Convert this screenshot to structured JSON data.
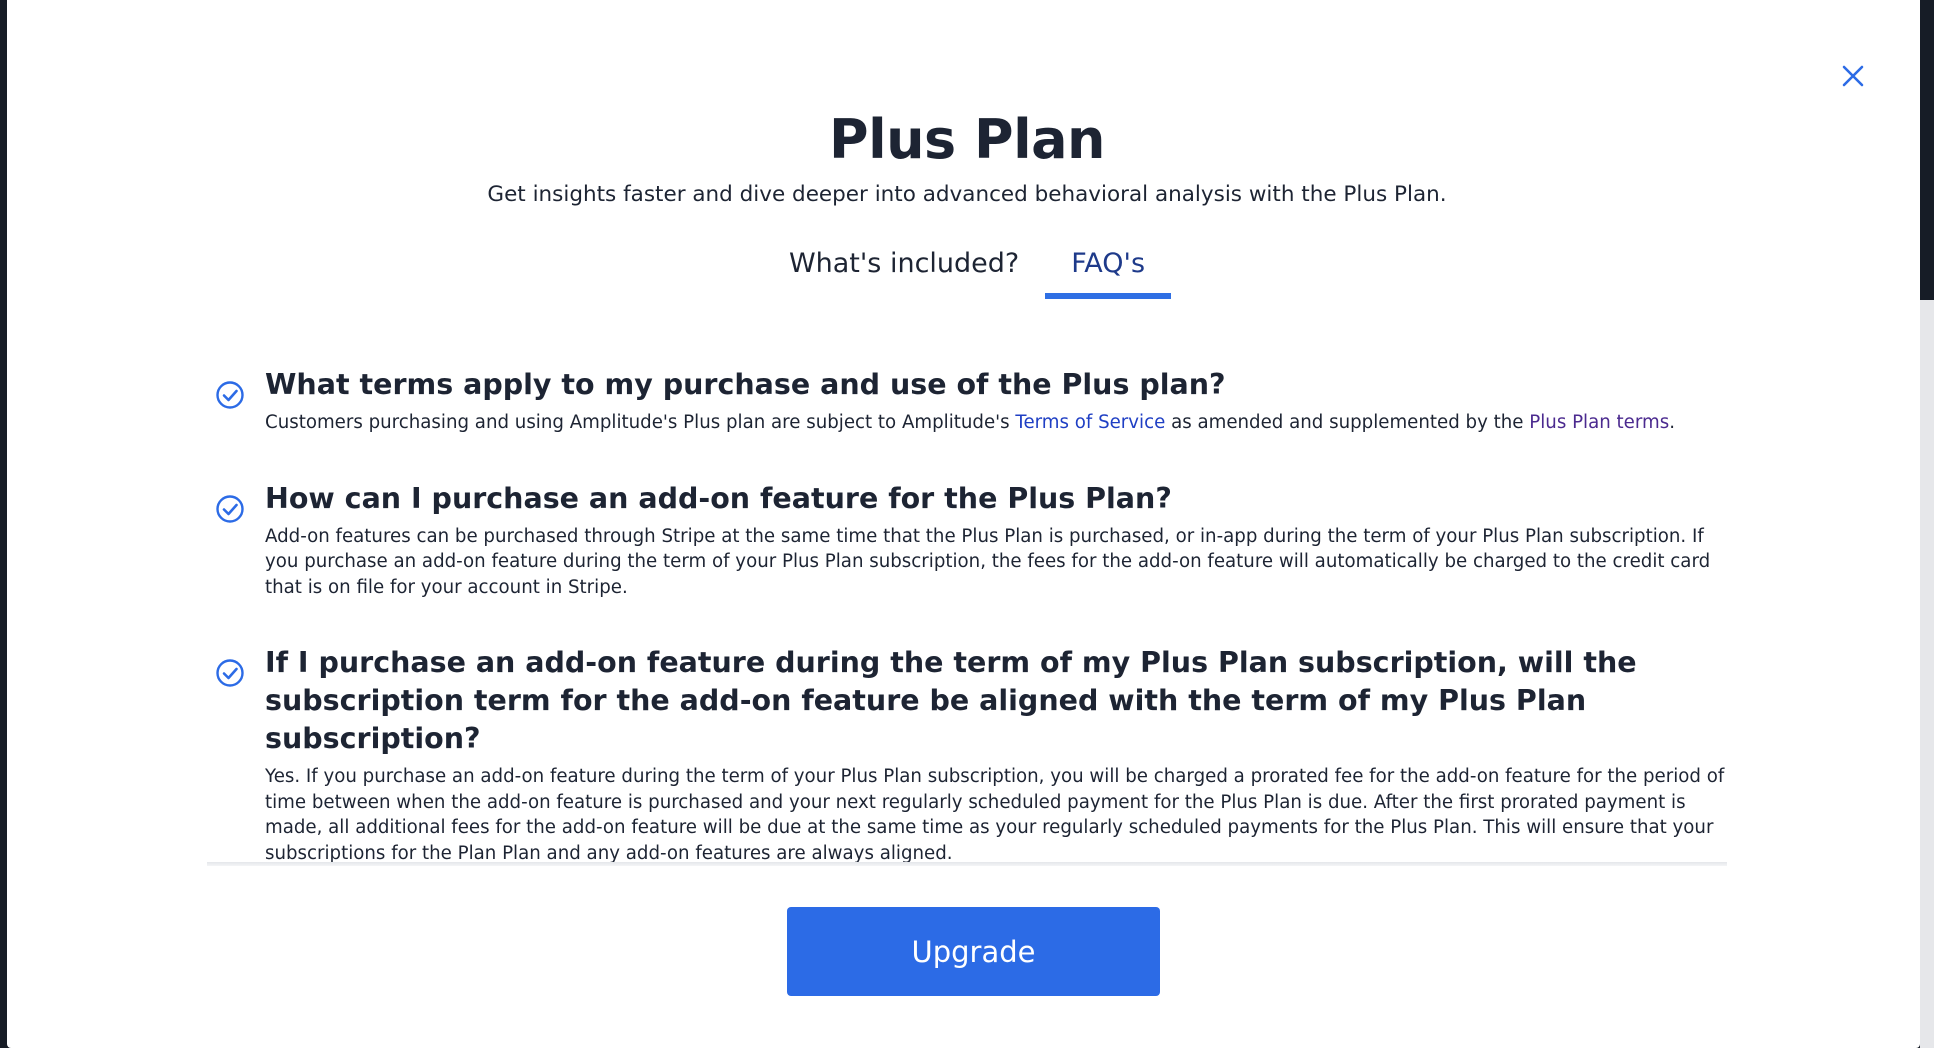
{
  "modal": {
    "title": "Plus Plan",
    "subtitle": "Get insights faster and dive deeper into advanced behavioral analysis with the Plus Plan.",
    "close_icon": "close-icon"
  },
  "tabs": [
    {
      "label": "What's included?",
      "active": false
    },
    {
      "label": "FAQ's",
      "active": true
    }
  ],
  "faqs": [
    {
      "icon": "check-circle-icon",
      "question": "What terms apply to my purchase and use of the Plus plan?",
      "answer_part1": "Customers purchasing and using Amplitude's Plus plan are subject to Amplitude's ",
      "link1": "Terms of Service",
      "answer_part2": " as amended and supplemented by the ",
      "link2": "Plus Plan terms",
      "answer_part3": "."
    },
    {
      "icon": "check-circle-icon",
      "question": "How can I purchase an add-on feature for the Plus Plan?",
      "answer": "Add-on features can be purchased through Stripe at the same time that the Plus Plan is purchased, or in-app during the term of your Plus Plan subscription. If you purchase an add-on feature during the term of your Plus Plan subscription, the fees for the add-on feature will automatically be charged to the credit card that is on file for your account in Stripe."
    },
    {
      "icon": "check-circle-icon",
      "question": "If I purchase an add-on feature during the term of my Plus Plan subscription, will the subscription term for the add-on feature be aligned with the term of my Plus Plan subscription?",
      "answer": "Yes. If you purchase an add-on feature during the term of your Plus Plan subscription, you will be charged a prorated fee for the add-on feature for the period of time between when the add-on feature is purchased and your next regularly scheduled payment for the Plus Plan is due. After the first prorated payment is made, all additional fees for the add-on feature will be due at the same time as your regularly scheduled payments for the Plus Plan. This will ensure that your subscriptions for the Plan Plan and any add-on features are always aligned."
    }
  ],
  "upgrade": {
    "label": "Upgrade"
  },
  "colors": {
    "accent": "#2c6be6",
    "text": "#1d2433",
    "link": "#1f3fc4",
    "link_visited": "#4b2a8f"
  }
}
